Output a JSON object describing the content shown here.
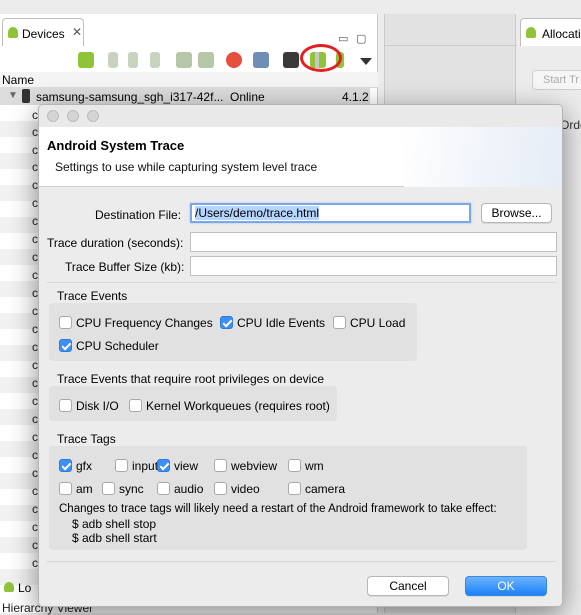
{
  "background": {
    "devices_tab": {
      "label": "Devices",
      "close_glyph": "✕"
    },
    "column_header": {
      "name": "Name"
    },
    "device": {
      "name": "samsung-samsung_sgh_i317-42f...",
      "status": "Online",
      "version": "4.1.2"
    },
    "client_prefix": "c",
    "allocation_tab": {
      "label": "Allocatio"
    },
    "start_button": "Start Tr",
    "orde_label": "Orde",
    "log_tab": {
      "label": "Lo"
    },
    "hierarchy_label": "Hierarchy Viewer"
  },
  "dialog": {
    "title": "Android System Trace",
    "subtitle": "Settings to use while capturing system level trace",
    "destination_label": "Destination File:",
    "destination_value": "/Users/demo/trace.html",
    "browse_label": "Browse...",
    "duration_label": "Trace duration (seconds):",
    "duration_value": "",
    "buffer_label": "Trace Buffer Size (kb):",
    "buffer_value": "",
    "trace_events": {
      "label": "Trace Events",
      "items": [
        {
          "label": "CPU Frequency Changes",
          "checked": false
        },
        {
          "label": "CPU Idle Events",
          "checked": true
        },
        {
          "label": "CPU Load",
          "checked": false
        },
        {
          "label": "CPU Scheduler",
          "checked": true
        }
      ]
    },
    "root_events": {
      "label": "Trace Events that require root privileges on device",
      "items": [
        {
          "label": "Disk I/O",
          "checked": false
        },
        {
          "label": "Kernel Workqueues (requires root)",
          "checked": false
        }
      ]
    },
    "trace_tags": {
      "label": "Trace Tags",
      "items": [
        {
          "label": "gfx",
          "checked": true
        },
        {
          "label": "input",
          "checked": false
        },
        {
          "label": "view",
          "checked": true
        },
        {
          "label": "webview",
          "checked": false
        },
        {
          "label": "wm",
          "checked": false
        },
        {
          "label": "am",
          "checked": false
        },
        {
          "label": "sync",
          "checked": false
        },
        {
          "label": "audio",
          "checked": false
        },
        {
          "label": "video",
          "checked": false
        },
        {
          "label": "camera",
          "checked": false
        }
      ],
      "note_line1": "Changes to trace tags will likely need a restart of the Android framework to take effect:",
      "note_line2": "$ adb shell stop",
      "note_line3": "$ adb shell start"
    },
    "cancel_label": "Cancel",
    "ok_label": "OK"
  },
  "colors": {
    "accent": "#3b8ff5",
    "annotation": "#e31e24",
    "ok_button": "#1a82fb"
  }
}
